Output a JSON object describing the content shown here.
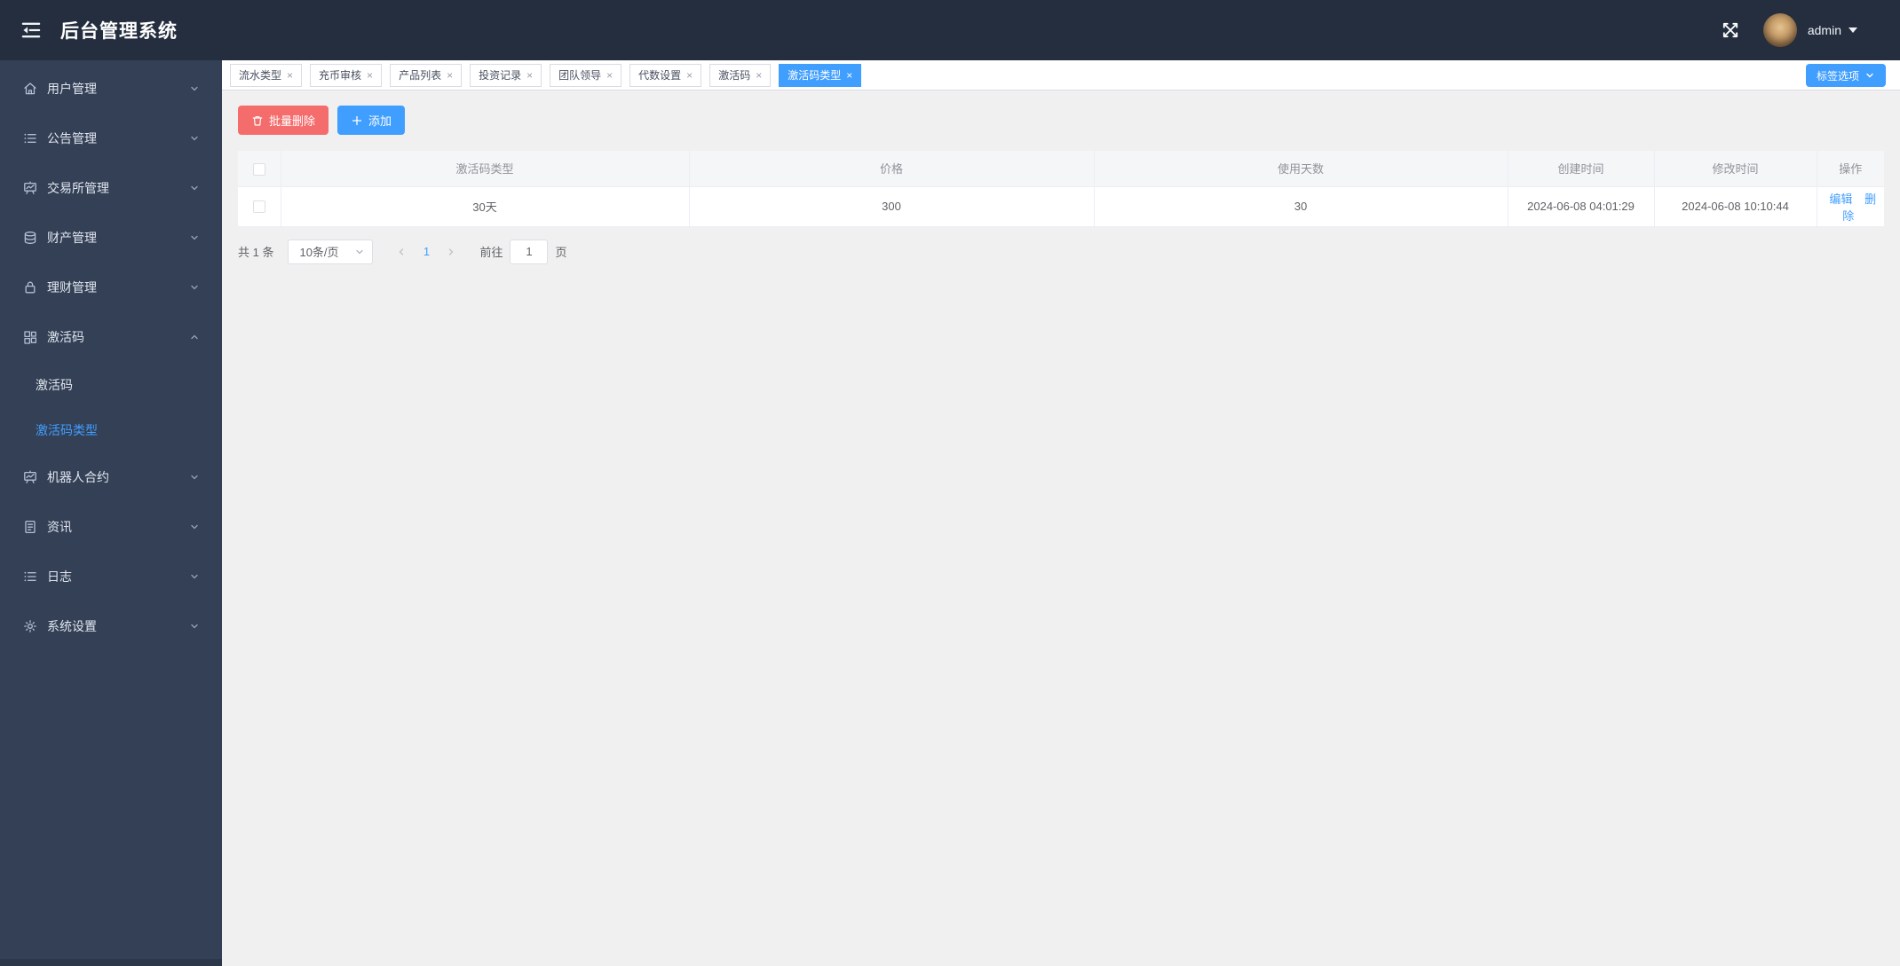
{
  "header": {
    "title": "后台管理系统",
    "username": "admin"
  },
  "sidebar": {
    "items": [
      {
        "label": "用户管理",
        "icon": "home-icon"
      },
      {
        "label": "公告管理",
        "icon": "list-icon"
      },
      {
        "label": "交易所管理",
        "icon": "presentation-board-icon"
      },
      {
        "label": "财产管理",
        "icon": "coins-icon"
      },
      {
        "label": "理财管理",
        "icon": "lock-icon"
      },
      {
        "label": "激活码",
        "icon": "grid-icon",
        "expanded": true
      },
      {
        "label": "机器人合约",
        "icon": "presentation-board-icon"
      },
      {
        "label": "资讯",
        "icon": "document-icon"
      },
      {
        "label": "日志",
        "icon": "list-icon"
      },
      {
        "label": "系统设置",
        "icon": "gear-icon"
      }
    ],
    "activation_submenu": [
      {
        "label": "激活码",
        "active": false
      },
      {
        "label": "激活码类型",
        "active": true
      }
    ]
  },
  "tabs": [
    {
      "label": "流水类型",
      "active": false
    },
    {
      "label": "充币审核",
      "active": false
    },
    {
      "label": "产品列表",
      "active": false
    },
    {
      "label": "投资记录",
      "active": false
    },
    {
      "label": "团队领导",
      "active": false
    },
    {
      "label": "代数设置",
      "active": false
    },
    {
      "label": "激活码",
      "active": false
    },
    {
      "label": "激活码类型",
      "active": true
    }
  ],
  "tabbar": {
    "close_glyph": "×",
    "tag_options_label": "标签选项"
  },
  "toolbar": {
    "batch_delete_label": "批量删除",
    "add_label": "添加"
  },
  "table": {
    "columns": {
      "type": "激活码类型",
      "price": "价格",
      "days": "使用天数",
      "created": "创建时间",
      "modified": "修改时间",
      "actions": "操作"
    },
    "rows": [
      {
        "type": "30天",
        "price": "300",
        "days": "30",
        "created_at": "2024-06-08 04:01:29",
        "updated_at": "2024-06-08 10:10:44",
        "edit_label": "编辑",
        "delete_label": "删除"
      }
    ]
  },
  "pagination": {
    "total_text": "共 1 条",
    "page_size_text": "10条/页",
    "current_page": "1",
    "goto_label": "前往",
    "goto_value": "1",
    "unit_label": "页"
  },
  "colors": {
    "accent": "#409EFF",
    "danger": "#F56C6C",
    "header_bg": "#242e3e",
    "sidebar_bg": "#344056",
    "content_bg": "#f0f0f0",
    "link": "#409EFF"
  }
}
